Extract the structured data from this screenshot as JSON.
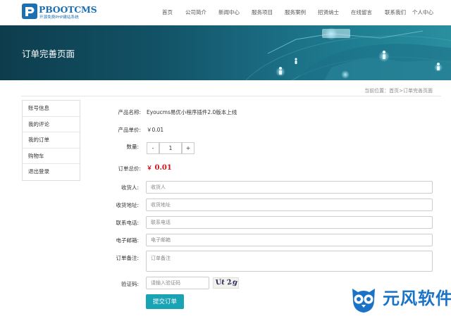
{
  "header": {
    "logo_title": "PBOOTCMS",
    "logo_subtitle": "开源免费PHP建站系统",
    "nav": [
      "首页",
      "公司简介",
      "新闻中心",
      "服务项目",
      "服务案例",
      "招贤纳士",
      "在线留言",
      "联系我们",
      "个人中心"
    ]
  },
  "banner": {
    "title": "订单完善页面"
  },
  "breadcrumb": {
    "prefix": "当前位置：",
    "home": "首页",
    "separator": ">",
    "current": "订单完善页面"
  },
  "sidebar": {
    "items": [
      {
        "label": "账号信息"
      },
      {
        "label": "我的评论"
      },
      {
        "label": "我的订单"
      },
      {
        "label": "购物车"
      },
      {
        "label": "退出登录"
      }
    ]
  },
  "order": {
    "product_name_label": "产品名称:",
    "product_name": "Eyoucms易优小程序插件2.0版本上线",
    "unit_price_label": "产品单价:",
    "unit_price": "￥0.01",
    "quantity_label": "数量:",
    "minus": "-",
    "quantity": "1",
    "plus": "+",
    "total_label": "订单总价:",
    "total_currency": "￥",
    "total_value": "0.01"
  },
  "form": {
    "consignee_label": "收货人:",
    "consignee_placeholder": "收货人",
    "address_label": "收货地址:",
    "address_placeholder": "收货地址",
    "phone_label": "联系电话:",
    "phone_placeholder": "联系电话",
    "email_label": "电子邮箱:",
    "email_placeholder": "电子邮箱",
    "remark_label": "订单备注:",
    "remark_placeholder": "订单备注",
    "captcha_label": "验证码:",
    "captcha_placeholder": "请输入验证码",
    "captcha_chars": [
      "U",
      "t",
      "2",
      "g"
    ],
    "submit_label": "提交订单"
  },
  "watermark": {
    "text": "元风软件"
  },
  "colors": {
    "brand": "#1b6fb3",
    "accent": "#1aa3b3",
    "price": "#d0141b"
  }
}
